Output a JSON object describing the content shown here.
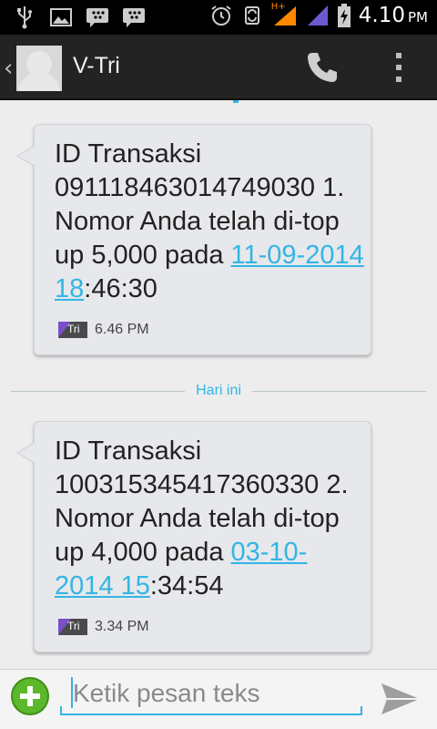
{
  "status_bar": {
    "network_label": "H+",
    "time": "4.10",
    "ampm": "PM"
  },
  "header": {
    "back_glyph": "‹",
    "title": "V-Tri"
  },
  "messages": [
    {
      "text_before": "ID Transaksi 091118463014749030 1. Nomor Anda telah di-top up 5,000 pada ",
      "link_text": "11-09-2014 18",
      "text_after": ":46:30",
      "sim_label": "Tri",
      "time": "6.46 PM"
    },
    {
      "text_before": "ID Transaksi 100315345417360330 2. Nomor Anda telah di-top up 4,000 pada ",
      "link_text": "03-10-2014 15",
      "text_after": ":34:54",
      "sim_label": "Tri",
      "time": "3.34 PM"
    }
  ],
  "date_divider": "Hari ini",
  "compose": {
    "placeholder": "Ketik pesan teks"
  },
  "colors": {
    "accent": "#33b5e5",
    "bubble": "#e6e8eb",
    "add_button": "#5cb82b",
    "signal": "#6a5acd",
    "network": "#ff8800"
  },
  "icons": {
    "usb": "usb-icon",
    "gallery": "gallery-icon",
    "bbm": "bbm-icon",
    "alarm": "alarm-icon",
    "sync": "sync-icon",
    "battery": "battery-charging-icon",
    "call": "phone-icon",
    "menu": "overflow-menu-icon",
    "add": "add-icon",
    "send": "send-icon"
  }
}
